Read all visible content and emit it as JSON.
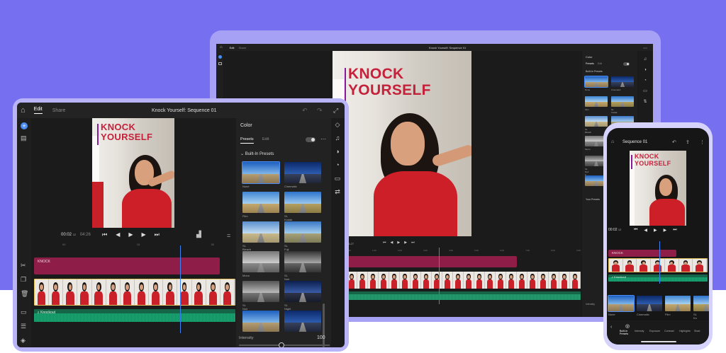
{
  "colors": {
    "accent": "#4b8cf5",
    "background": "#7670f0",
    "title_red": "#c6213a",
    "track_red": "#8e1e48",
    "track_green": "#156548"
  },
  "video_title": {
    "line1": "KNOCK",
    "line2": "YOURSELF"
  },
  "presets": [
    "None",
    "Cinematic",
    "Film",
    "SL Kodak",
    "SL Bleach",
    "SL Fuji",
    "Mono",
    "SL Noir 1",
    "SL Noir 2",
    "SL Night"
  ],
  "tablet": {
    "tab_edit": "Edit",
    "tab_share": "Share",
    "seq_title": "Knock Yourself: Sequence 01",
    "time_current": "00:02",
    "time_frames": "12",
    "time_total": "04:26",
    "panel_title": "Color",
    "tab_presets": "Presets",
    "tab_edit2": "Edit",
    "section_title": "Built-In Presets",
    "track_title": "KNOCK",
    "audio_label": "Knockout",
    "intensity_label": "Intensity",
    "intensity_value": "100",
    "ruler_ticks": [
      "00",
      "15",
      "30"
    ],
    "icons": [
      "home-icon",
      "undo-icon",
      "redo-icon",
      "add-icon",
      "media-icon",
      "razor-icon",
      "copy-icon",
      "trash-icon",
      "layers-icon",
      "list-icon",
      "transform-icon",
      "more-icon",
      "color-icon",
      "audio-icon",
      "speed-icon",
      "crop-icon",
      "swap-icon"
    ]
  },
  "laptop": {
    "tab_edit": "Edit",
    "tab_share": "Share",
    "seq_title": "Knock Yourself: Sequence 01",
    "time_display": "04:27",
    "panel_title": "Color",
    "tab_presets": "Presets",
    "tab_edit2": "Edit",
    "section_title": "Built-In Presets",
    "section_yours": "Your Presets",
    "intensity_label": "Intensity",
    "ruler_ticks": [
      "0:00",
      "1:00",
      "2:00",
      "3:00",
      "4:00",
      "5:00",
      "6:00",
      "7:00",
      "8:00",
      "9:00"
    ]
  },
  "phone": {
    "seq_title": "Sequence 01",
    "time_current": "00:02",
    "time_frames": "12",
    "track_title": "KNOCK",
    "audio_label": "Knockout",
    "preset_labels": [
      "None",
      "Cinematic",
      "Film",
      "SL Ko"
    ],
    "bottom_tabs": [
      "Built-in Presets",
      "Intensity",
      "Exposure",
      "Contrast",
      "Highlights",
      "Shad"
    ]
  }
}
